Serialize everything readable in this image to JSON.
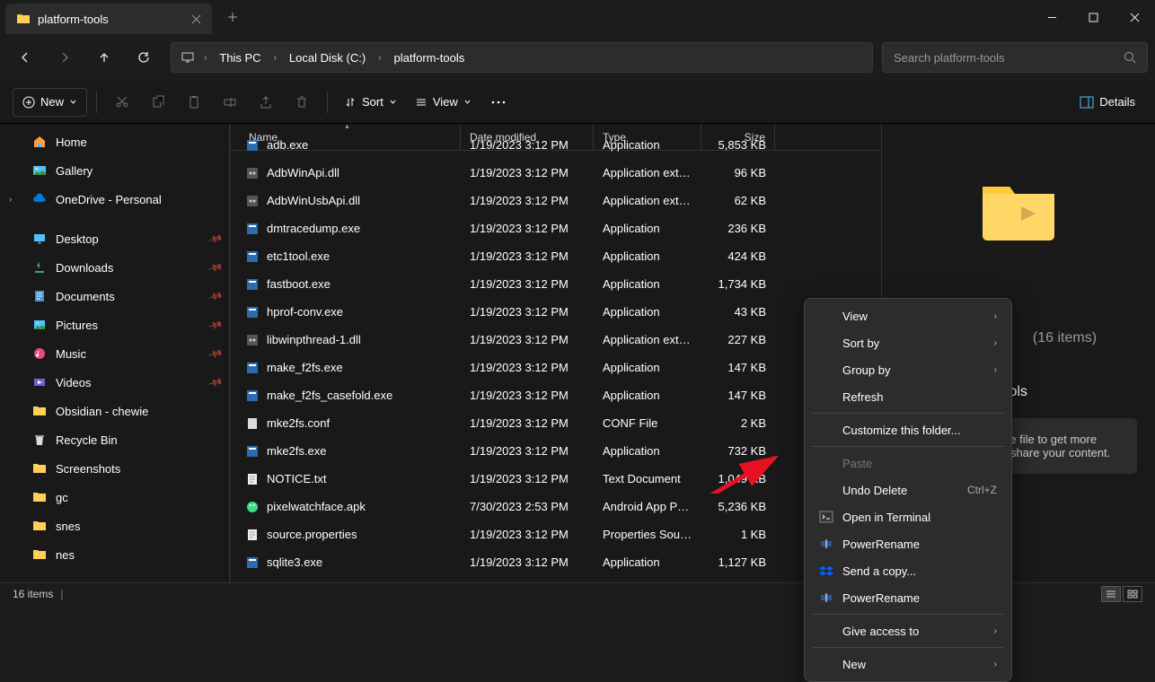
{
  "window": {
    "tab_title": "platform-tools"
  },
  "breadcrumb": {
    "items": [
      "This PC",
      "Local Disk (C:)",
      "platform-tools"
    ]
  },
  "search": {
    "placeholder": "Search platform-tools"
  },
  "toolbar": {
    "new": "New",
    "sort": "Sort",
    "view": "View",
    "details_toggle": "Details"
  },
  "columns": {
    "name": "Name",
    "date": "Date modified",
    "type": "Type",
    "size": "Size"
  },
  "sidebar": {
    "home": "Home",
    "gallery": "Gallery",
    "onedrive": "OneDrive - Personal",
    "quick": [
      {
        "label": "Desktop",
        "icon": "desktop"
      },
      {
        "label": "Downloads",
        "icon": "downloads"
      },
      {
        "label": "Documents",
        "icon": "documents"
      },
      {
        "label": "Pictures",
        "icon": "pictures"
      },
      {
        "label": "Music",
        "icon": "music"
      },
      {
        "label": "Videos",
        "icon": "videos"
      },
      {
        "label": "Obsidian - chewie",
        "icon": "folder"
      },
      {
        "label": "Recycle Bin",
        "icon": "recycle"
      },
      {
        "label": "Screenshots",
        "icon": "folder"
      },
      {
        "label": "gc",
        "icon": "folder"
      },
      {
        "label": "snes",
        "icon": "folder"
      },
      {
        "label": "nes",
        "icon": "folder"
      }
    ]
  },
  "files": [
    {
      "name": "adb.exe",
      "date": "1/19/2023 3:12 PM",
      "type": "Application",
      "size": "5,853 KB",
      "icon": "exe"
    },
    {
      "name": "AdbWinApi.dll",
      "date": "1/19/2023 3:12 PM",
      "type": "Application exten...",
      "size": "96 KB",
      "icon": "dll"
    },
    {
      "name": "AdbWinUsbApi.dll",
      "date": "1/19/2023 3:12 PM",
      "type": "Application exten...",
      "size": "62 KB",
      "icon": "dll"
    },
    {
      "name": "dmtracedump.exe",
      "date": "1/19/2023 3:12 PM",
      "type": "Application",
      "size": "236 KB",
      "icon": "exe"
    },
    {
      "name": "etc1tool.exe",
      "date": "1/19/2023 3:12 PM",
      "type": "Application",
      "size": "424 KB",
      "icon": "exe"
    },
    {
      "name": "fastboot.exe",
      "date": "1/19/2023 3:12 PM",
      "type": "Application",
      "size": "1,734 KB",
      "icon": "exe"
    },
    {
      "name": "hprof-conv.exe",
      "date": "1/19/2023 3:12 PM",
      "type": "Application",
      "size": "43 KB",
      "icon": "exe"
    },
    {
      "name": "libwinpthread-1.dll",
      "date": "1/19/2023 3:12 PM",
      "type": "Application exten...",
      "size": "227 KB",
      "icon": "dll"
    },
    {
      "name": "make_f2fs.exe",
      "date": "1/19/2023 3:12 PM",
      "type": "Application",
      "size": "147 KB",
      "icon": "exe"
    },
    {
      "name": "make_f2fs_casefold.exe",
      "date": "1/19/2023 3:12 PM",
      "type": "Application",
      "size": "147 KB",
      "icon": "exe"
    },
    {
      "name": "mke2fs.conf",
      "date": "1/19/2023 3:12 PM",
      "type": "CONF File",
      "size": "2 KB",
      "icon": "file"
    },
    {
      "name": "mke2fs.exe",
      "date": "1/19/2023 3:12 PM",
      "type": "Application",
      "size": "732 KB",
      "icon": "exe"
    },
    {
      "name": "NOTICE.txt",
      "date": "1/19/2023 3:12 PM",
      "type": "Text Document",
      "size": "1,049 KB",
      "icon": "txt"
    },
    {
      "name": "pixelwatchface.apk",
      "date": "7/30/2023 2:53 PM",
      "type": "Android App Pack...",
      "size": "5,236 KB",
      "icon": "apk"
    },
    {
      "name": "source.properties",
      "date": "1/19/2023 3:12 PM",
      "type": "Properties Source ...",
      "size": "1 KB",
      "icon": "txt"
    },
    {
      "name": "sqlite3.exe",
      "date": "1/19/2023 3:12 PM",
      "type": "Application",
      "size": "1,127 KB",
      "icon": "exe"
    }
  ],
  "details_pane": {
    "name": "platform-tools",
    "count": "(16 items)",
    "tip": "Select a single file to get more information and share your content."
  },
  "context_menu": {
    "view": "View",
    "sort_by": "Sort by",
    "group_by": "Group by",
    "refresh": "Refresh",
    "customize": "Customize this folder...",
    "paste": "Paste",
    "undo_delete": "Undo Delete",
    "undo_shortcut": "Ctrl+Z",
    "open_terminal": "Open in Terminal",
    "powerrename1": "PowerRename",
    "send_copy": "Send a copy...",
    "powerrename2": "PowerRename",
    "give_access": "Give access to",
    "new": "New"
  },
  "statusbar": {
    "count": "16 items"
  }
}
